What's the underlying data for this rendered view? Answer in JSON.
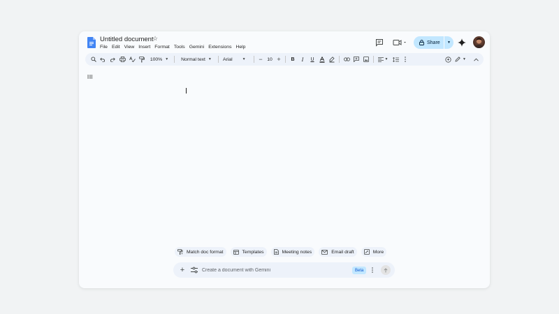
{
  "document": {
    "title": "Untitled document"
  },
  "menubar": {
    "items": [
      "File",
      "Edit",
      "View",
      "Insert",
      "Format",
      "Tools",
      "Gemini",
      "Extensions",
      "Help"
    ]
  },
  "header": {
    "share_label": "Share"
  },
  "toolbar": {
    "zoom": "100%",
    "style": "Normal text",
    "font": "Arial",
    "font_size": "10"
  },
  "chips": [
    {
      "label": "Match doc format",
      "icon": "match-format-icon"
    },
    {
      "label": "Templates",
      "icon": "templates-icon"
    },
    {
      "label": "Meeting notes",
      "icon": "meeting-notes-icon"
    },
    {
      "label": "Email draft",
      "icon": "email-icon"
    },
    {
      "label": "More",
      "icon": "more-icon"
    }
  ],
  "gemini_bar": {
    "placeholder": "Create a document with Gemini",
    "badge": "Beta"
  },
  "colors": {
    "share_bg": "#c2e7ff",
    "docs_blue": "#4285f4",
    "toolbar_bg": "#edf2fa"
  }
}
